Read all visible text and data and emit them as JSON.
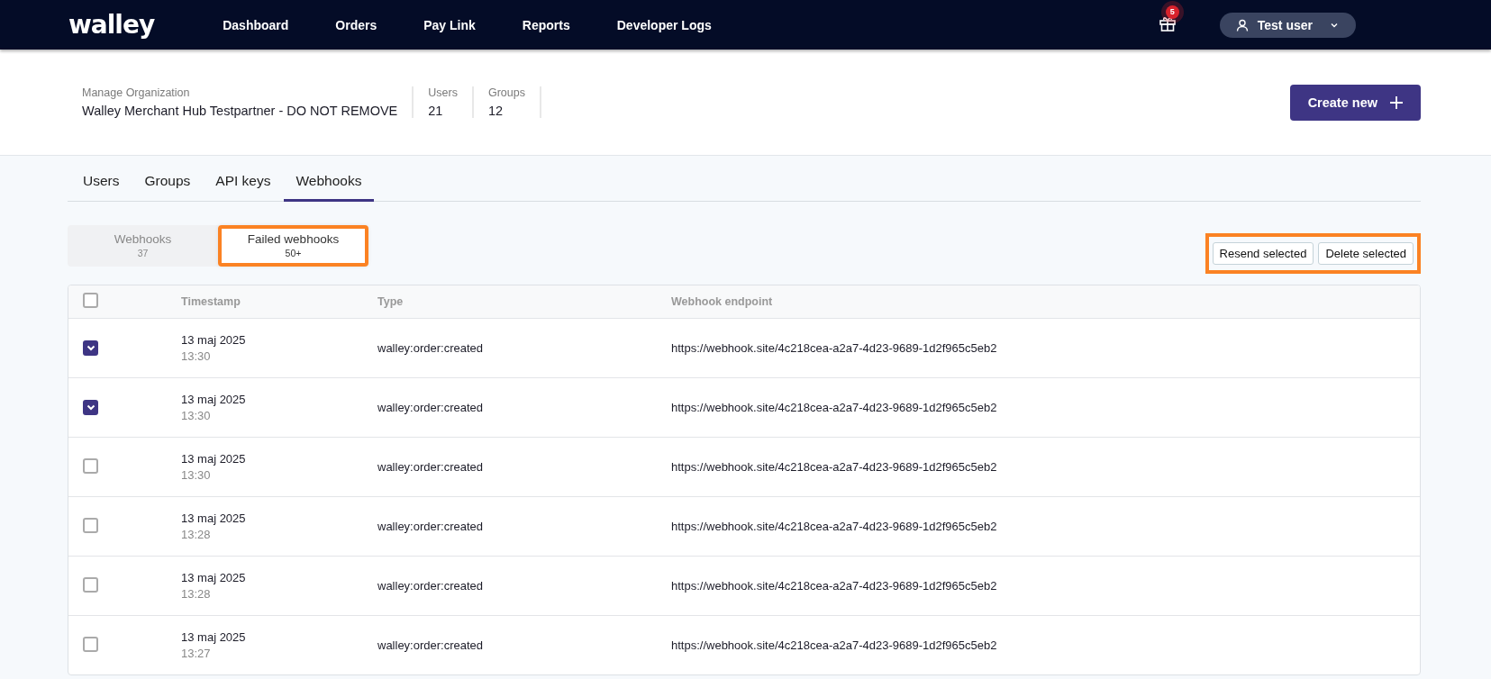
{
  "header": {
    "logo": "walley",
    "nav": [
      {
        "label": "Dashboard"
      },
      {
        "label": "Orders"
      },
      {
        "label": "Pay Link"
      },
      {
        "label": "Reports"
      },
      {
        "label": "Developer Logs"
      }
    ],
    "notifications_badge": "5",
    "user": "Test user"
  },
  "organization": {
    "label": "Manage Organization",
    "name": "Walley Merchant Hub Testpartner - DO NOT REMOVE",
    "stats": [
      {
        "label": "Users",
        "value": "21"
      },
      {
        "label": "Groups",
        "value": "12"
      }
    ],
    "create_button": "Create new"
  },
  "tabs": [
    {
      "label": "Users",
      "selected": false
    },
    {
      "label": "Groups",
      "selected": false
    },
    {
      "label": "API keys",
      "selected": false
    },
    {
      "label": "Webhooks",
      "selected": true
    }
  ],
  "subtabs": [
    {
      "label": "Webhooks",
      "count": "37",
      "selected": false,
      "highlighted": false
    },
    {
      "label": "Failed webhooks",
      "count": "50+",
      "selected": true,
      "highlighted": true
    }
  ],
  "actions": {
    "highlighted": true,
    "buttons": [
      "Resend selected",
      "Delete selected"
    ]
  },
  "table": {
    "select_all_checked": false,
    "columns": [
      "Timestamp",
      "Type",
      "Webhook endpoint"
    ],
    "rows": [
      {
        "checked": true,
        "date": "13 maj 2025",
        "time": "13:30",
        "type": "walley:order:created",
        "endpoint": "https://webhook.site/4c218cea-a2a7-4d23-9689-1d2f965c5eb2"
      },
      {
        "checked": true,
        "date": "13 maj 2025",
        "time": "13:30",
        "type": "walley:order:created",
        "endpoint": "https://webhook.site/4c218cea-a2a7-4d23-9689-1d2f965c5eb2"
      },
      {
        "checked": false,
        "date": "13 maj 2025",
        "time": "13:30",
        "type": "walley:order:created",
        "endpoint": "https://webhook.site/4c218cea-a2a7-4d23-9689-1d2f965c5eb2"
      },
      {
        "checked": false,
        "date": "13 maj 2025",
        "time": "13:28",
        "type": "walley:order:created",
        "endpoint": "https://webhook.site/4c218cea-a2a7-4d23-9689-1d2f965c5eb2"
      },
      {
        "checked": false,
        "date": "13 maj 2025",
        "time": "13:28",
        "type": "walley:order:created",
        "endpoint": "https://webhook.site/4c218cea-a2a7-4d23-9689-1d2f965c5eb2"
      },
      {
        "checked": false,
        "date": "13 maj 2025",
        "time": "13:27",
        "type": "walley:order:created",
        "endpoint": "https://webhook.site/4c218cea-a2a7-4d23-9689-1d2f965c5eb2"
      }
    ]
  }
}
